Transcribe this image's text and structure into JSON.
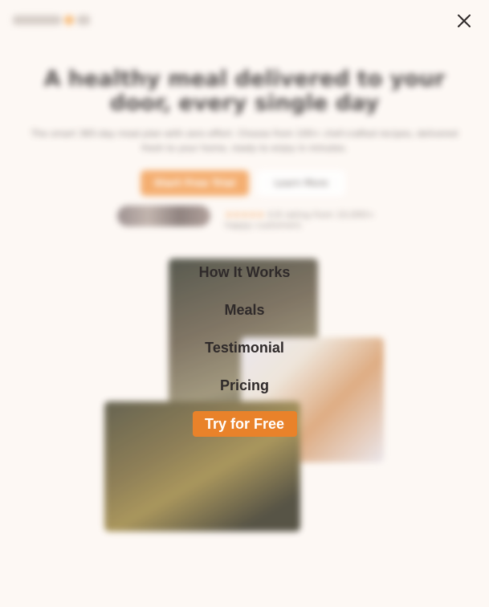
{
  "hero": {
    "title": "A healthy meal delivered to your door, every single day",
    "subtitle": "The smart 365-day meal plan with zero effort. Choose from 100+ chef-crafted recipes, delivered fresh to your home, ready to enjoy in minutes.",
    "primary_cta": "Start Free Trial",
    "secondary_cta": "Learn More",
    "rating_stars": "★★★★★",
    "rating_text": "4.8 rating from 10,000+ happy customers"
  },
  "menu": {
    "items": [
      {
        "label": "How It Works"
      },
      {
        "label": "Meals"
      },
      {
        "label": "Testimonial"
      },
      {
        "label": "Pricing"
      }
    ],
    "cta_label": "Try for Free"
  },
  "colors": {
    "accent": "#e9822a",
    "background": "#fdf8f4",
    "text": "#2f2a2a"
  },
  "icons": {
    "close": "close-icon"
  }
}
